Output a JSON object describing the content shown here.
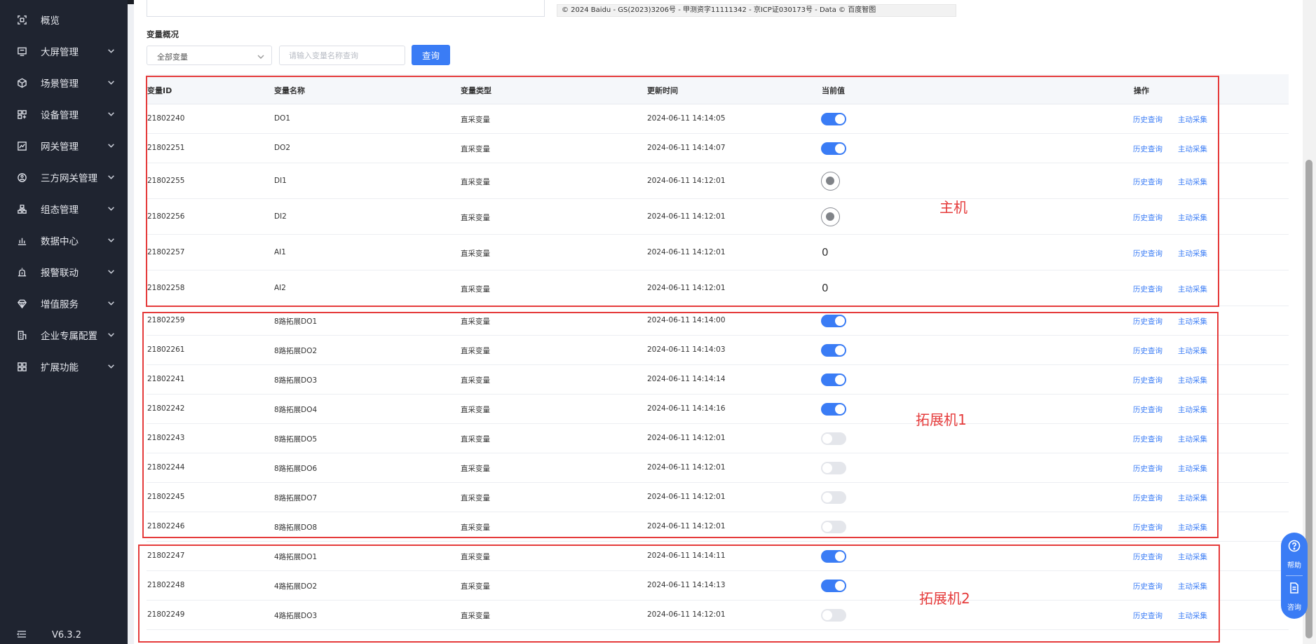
{
  "sidebar": {
    "items": [
      {
        "label": "概览",
        "icon": "overview-icon",
        "expandable": false
      },
      {
        "label": "大屏管理",
        "icon": "monitor-icon",
        "expandable": true
      },
      {
        "label": "场景管理",
        "icon": "cube-icon",
        "expandable": true
      },
      {
        "label": "设备管理",
        "icon": "device-grid-icon",
        "expandable": true
      },
      {
        "label": "网关管理",
        "icon": "gateway-chart-icon",
        "expandable": true
      },
      {
        "label": "三方网关管理",
        "icon": "third-party-gateway-icon",
        "expandable": true
      },
      {
        "label": "组态管理",
        "icon": "topology-icon",
        "expandable": true
      },
      {
        "label": "数据中心",
        "icon": "bar-chart-icon",
        "expandable": true
      },
      {
        "label": "报警联动",
        "icon": "alarm-icon",
        "expandable": true
      },
      {
        "label": "增值服务",
        "icon": "diamond-icon",
        "expandable": true
      },
      {
        "label": "企业专属配置",
        "icon": "building-icon",
        "expandable": true
      },
      {
        "label": "扩展功能",
        "icon": "apps-icon",
        "expandable": true
      }
    ],
    "version": "V6.3.2"
  },
  "map": {
    "copyright": "© 2024 Baidu - GS(2023)3206号 - 甲测资字11111342 - 京ICP证030173号 - Data © 百度智图"
  },
  "filters": {
    "section_title": "变量概况",
    "select_value": "全部变量",
    "search_placeholder": "请输入变量名称查询",
    "query_label": "查询"
  },
  "table": {
    "headers": [
      "变量ID",
      "变量名称",
      "变量类型",
      "更新时间",
      "当前值",
      "操作"
    ],
    "action_history": "历史查询",
    "action_collect": "主动采集",
    "rows": [
      {
        "id": "21802240",
        "name": "DO1",
        "type": "直采变量",
        "time": "2024-06-11 14:14:05",
        "kind": "toggle",
        "on": true
      },
      {
        "id": "21802251",
        "name": "DO2",
        "type": "直采变量",
        "time": "2024-06-11 14:14:07",
        "kind": "toggle",
        "on": true
      },
      {
        "id": "21802255",
        "name": "DI1",
        "type": "直采变量",
        "time": "2024-06-11 14:12:01",
        "kind": "radio"
      },
      {
        "id": "21802256",
        "name": "DI2",
        "type": "直采变量",
        "time": "2024-06-11 14:12:01",
        "kind": "radio"
      },
      {
        "id": "21802257",
        "name": "AI1",
        "type": "直采变量",
        "time": "2024-06-11 14:12:01",
        "kind": "number",
        "value": "0"
      },
      {
        "id": "21802258",
        "name": "AI2",
        "type": "直采变量",
        "time": "2024-06-11 14:12:01",
        "kind": "number",
        "value": "0"
      },
      {
        "id": "21802259",
        "name": "8路拓展DO1",
        "type": "直采变量",
        "time": "2024-06-11 14:14:00",
        "kind": "toggle",
        "on": true
      },
      {
        "id": "21802261",
        "name": "8路拓展DO2",
        "type": "直采变量",
        "time": "2024-06-11 14:14:03",
        "kind": "toggle",
        "on": true
      },
      {
        "id": "21802241",
        "name": "8路拓展DO3",
        "type": "直采变量",
        "time": "2024-06-11 14:14:14",
        "kind": "toggle",
        "on": true
      },
      {
        "id": "21802242",
        "name": "8路拓展DO4",
        "type": "直采变量",
        "time": "2024-06-11 14:14:16",
        "kind": "toggle",
        "on": true
      },
      {
        "id": "21802243",
        "name": "8路拓展DO5",
        "type": "直采变量",
        "time": "2024-06-11 14:12:01",
        "kind": "toggle",
        "on": false
      },
      {
        "id": "21802244",
        "name": "8路拓展DO6",
        "type": "直采变量",
        "time": "2024-06-11 14:12:01",
        "kind": "toggle",
        "on": false
      },
      {
        "id": "21802245",
        "name": "8路拓展DO7",
        "type": "直采变量",
        "time": "2024-06-11 14:12:01",
        "kind": "toggle",
        "on": false
      },
      {
        "id": "21802246",
        "name": "8路拓展DO8",
        "type": "直采变量",
        "time": "2024-06-11 14:12:01",
        "kind": "toggle",
        "on": false
      },
      {
        "id": "21802247",
        "name": "4路拓展DO1",
        "type": "直采变量",
        "time": "2024-06-11 14:14:11",
        "kind": "toggle",
        "on": true
      },
      {
        "id": "21802248",
        "name": "4路拓展DO2",
        "type": "直采变量",
        "time": "2024-06-11 14:14:13",
        "kind": "toggle",
        "on": true
      },
      {
        "id": "21802249",
        "name": "4路拓展DO3",
        "type": "直采变量",
        "time": "2024-06-11 14:12:01",
        "kind": "toggle",
        "on": false
      }
    ]
  },
  "annotations": {
    "host": "主机",
    "ext1": "拓展机1",
    "ext2": "拓展机2",
    "color": "#e53b3b"
  },
  "helper": {
    "help": "帮助",
    "consult": "咨询"
  },
  "colors": {
    "accent": "#3a7cf5",
    "sidebar_bg": "#1f2430"
  }
}
